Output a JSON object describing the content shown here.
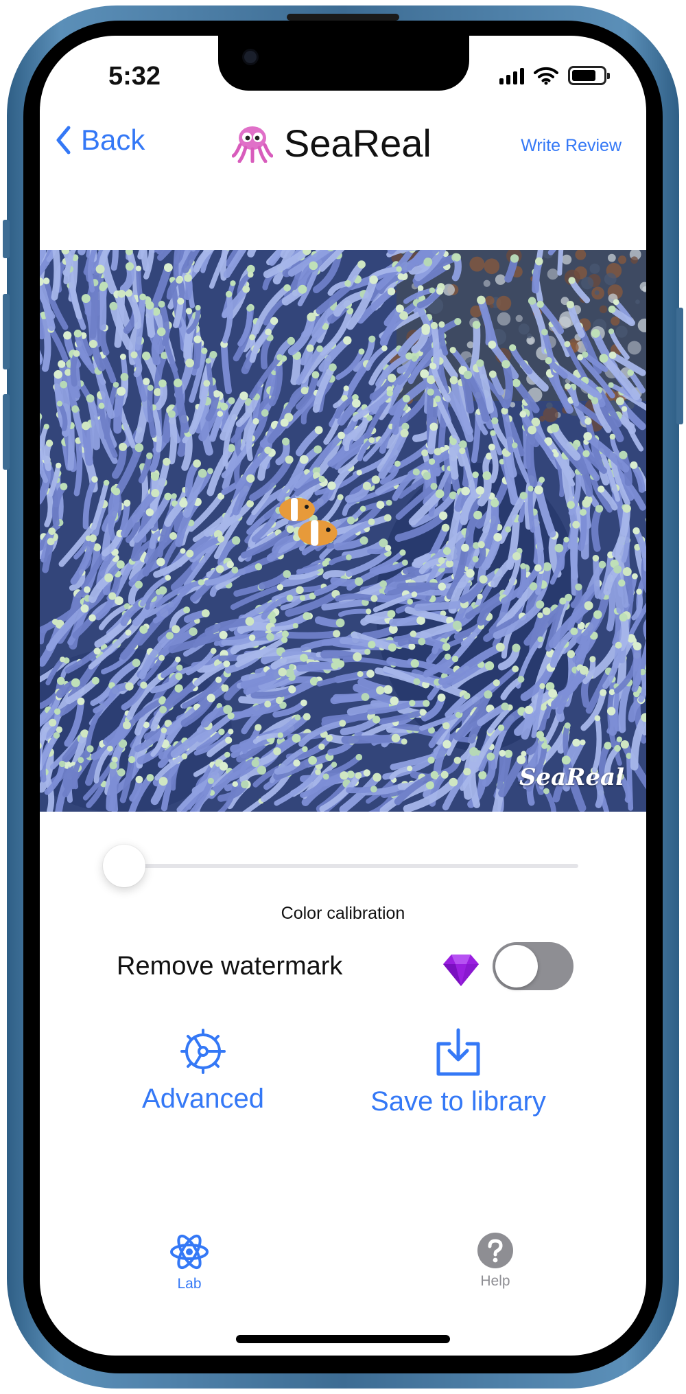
{
  "status_bar": {
    "time": "5:32"
  },
  "nav": {
    "back_label": "Back",
    "app_title": "SeaReal",
    "mascot_icon": "octopus-icon",
    "review_label": "Write Review"
  },
  "photo": {
    "watermark_text": "SeaReal"
  },
  "calibration": {
    "label": "Color calibration",
    "value": 0
  },
  "watermark_option": {
    "label": "Remove watermark",
    "enabled": false,
    "premium_icon": "gem-icon"
  },
  "actions": {
    "advanced": {
      "label": "Advanced",
      "icon": "gear-icon"
    },
    "save": {
      "label": "Save to library",
      "icon": "download-icon"
    }
  },
  "tab_bar": {
    "tabs": [
      {
        "label": "Lab",
        "icon": "atom-icon",
        "active": true
      },
      {
        "label": "Help",
        "icon": "question-icon",
        "active": false
      }
    ]
  },
  "colors": {
    "accent": "#3478f6",
    "inactive": "#8e8e93",
    "toggle_off": "#8e8e93",
    "premium": "#9a1fe0"
  }
}
